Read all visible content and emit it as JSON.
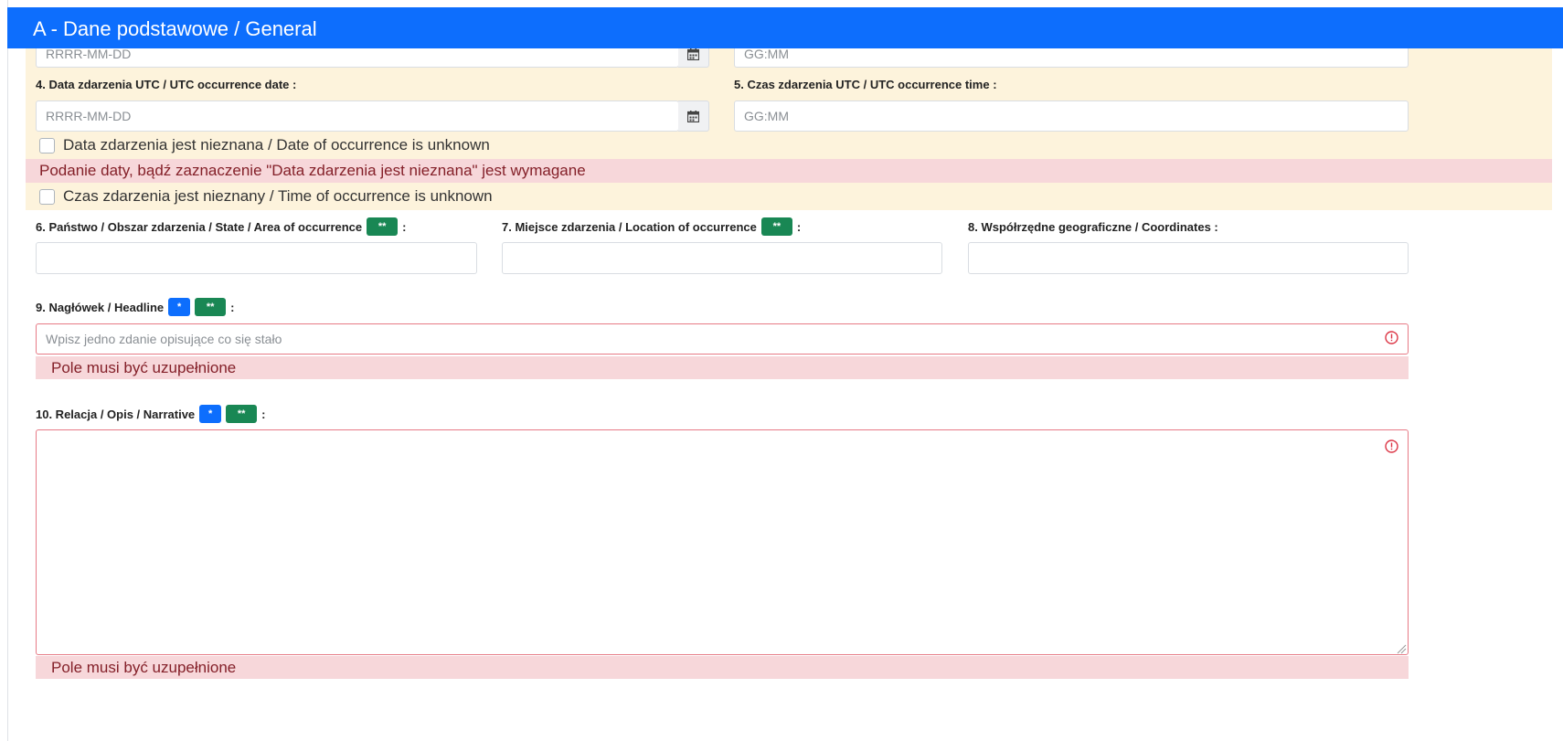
{
  "header": {
    "title": "A - Dane podstawowe / General"
  },
  "local_date": {
    "placeholder": "RRRR-MM-DD"
  },
  "local_time": {
    "placeholder": "GG:MM"
  },
  "utc_date": {
    "label": "4. Data zdarzenia UTC / UTC occurrence date :",
    "placeholder": "RRRR-MM-DD"
  },
  "utc_time": {
    "label": "5. Czas zdarzenia UTC / UTC occurrence time :",
    "placeholder": "GG:MM"
  },
  "date_unknown": {
    "label": "Data zdarzenia jest nieznana / Date of occurrence is unknown",
    "checked": false
  },
  "date_error": "Podanie daty, bądź zaznaczenie \"Data zdarzenia jest nieznana\" jest wymagane",
  "time_unknown": {
    "label": "Czas zdarzenia jest nieznany / Time of occurrence is unknown",
    "checked": false
  },
  "state": {
    "label": "6. Państwo / Obszar zdarzenia / State / Area of occurrence",
    "badge": "**",
    "colon": ":"
  },
  "location": {
    "label": "7. Miejsce zdarzenia / Location of occurrence",
    "badge": "**",
    "colon": ":"
  },
  "coordinates": {
    "label": "8. Współrzędne geograficzne / Coordinates :"
  },
  "headline": {
    "label": "9. Nagłówek / Headline",
    "badge_required": "*",
    "badge_extra": "**",
    "colon": ":",
    "placeholder": "Wpisz jedno zdanie opisujące co się stało",
    "error": "Pole musi być uzupełnione"
  },
  "narrative": {
    "label": "10. Relacja / Opis / Narrative",
    "badge_required": "*",
    "badge_extra": "**",
    "colon": ":",
    "error": "Pole musi być uzupełnione"
  },
  "icons": {
    "calendar": "calendar-icon",
    "error": "exclamation-circle-icon"
  },
  "colors": {
    "header": "#0d6efd",
    "section_bg": "#fdf3dc",
    "error_bg": "#f7d7da",
    "badge_blue": "#0d6efd",
    "badge_green": "#198754",
    "invalid_border": "#e77a86"
  }
}
